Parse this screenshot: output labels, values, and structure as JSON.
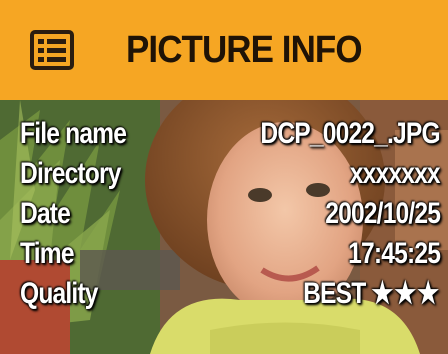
{
  "header": {
    "title": "PICTURE INFO",
    "icon": "list-icon",
    "background_color": "#f6a623"
  },
  "info": [
    {
      "key": "file_name",
      "label": "File name",
      "value": "DCP_0022_.JPG"
    },
    {
      "key": "directory",
      "label": "Directory",
      "value": "xxxxxxx"
    },
    {
      "key": "date",
      "label": "Date",
      "value": "2002/10/25"
    },
    {
      "key": "time",
      "label": "Time",
      "value": "17:45:25"
    },
    {
      "key": "quality",
      "label": "Quality",
      "value": "BEST",
      "stars": "★★★"
    }
  ]
}
